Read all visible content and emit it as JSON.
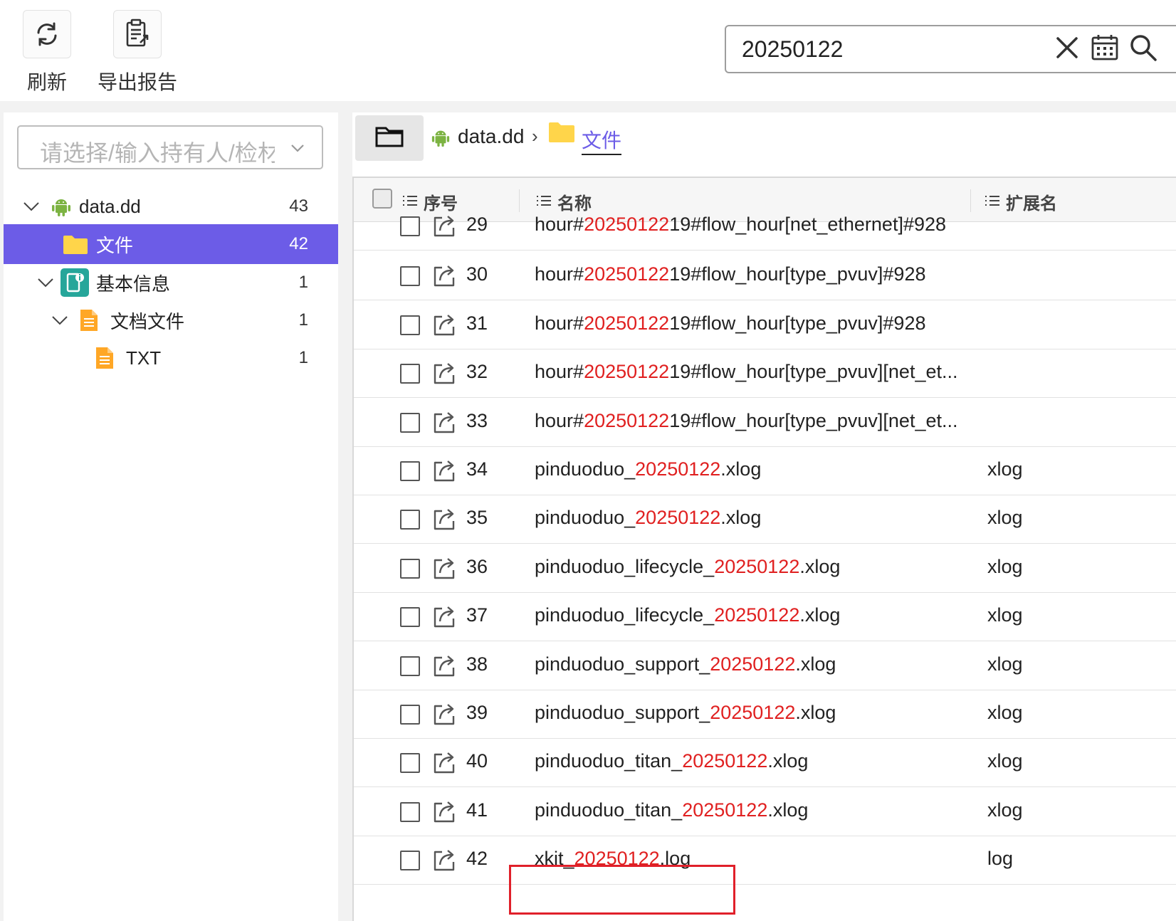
{
  "toolbar": {
    "refresh_label": "刷新",
    "export_label": "导出报告"
  },
  "search": {
    "value": "20250122"
  },
  "left": {
    "owner_placeholder": "请选择/输入持有人/检材",
    "tree": [
      {
        "label": "data.dd",
        "count": "43",
        "level": 0,
        "icon": "android-icon",
        "expanded": true
      },
      {
        "label": "文件",
        "count": "42",
        "level": 1,
        "icon": "folder-icon",
        "selected": true
      },
      {
        "label": "基本信息",
        "count": "1",
        "level": 1,
        "icon": "device-info-icon",
        "expanded": true
      },
      {
        "label": "文档文件",
        "count": "1",
        "level": 2,
        "icon": "document-icon",
        "expanded": true
      },
      {
        "label": "TXT",
        "count": "1",
        "level": 3,
        "icon": "document-icon"
      }
    ]
  },
  "breadcrumb": {
    "root": "data.dd",
    "current": "文件"
  },
  "table": {
    "headers": {
      "index": "序号",
      "name": "名称",
      "ext": "扩展名"
    },
    "rows": [
      {
        "num": "29",
        "pre": "hour#",
        "hl": "20250122",
        "post": "19#flow_hour[net_ethernet]#928",
        "ext": ""
      },
      {
        "num": "30",
        "pre": "hour#",
        "hl": "20250122",
        "post": "19#flow_hour[type_pvuv]#928",
        "ext": ""
      },
      {
        "num": "31",
        "pre": "hour#",
        "hl": "20250122",
        "post": "19#flow_hour[type_pvuv]#928",
        "ext": ""
      },
      {
        "num": "32",
        "pre": "hour#",
        "hl": "20250122",
        "post": "19#flow_hour[type_pvuv][net_et...",
        "ext": ""
      },
      {
        "num": "33",
        "pre": "hour#",
        "hl": "20250122",
        "post": "19#flow_hour[type_pvuv][net_et...",
        "ext": ""
      },
      {
        "num": "34",
        "pre": "pinduoduo_",
        "hl": "20250122",
        "post": ".xlog",
        "ext": "xlog"
      },
      {
        "num": "35",
        "pre": "pinduoduo_",
        "hl": "20250122",
        "post": ".xlog",
        "ext": "xlog"
      },
      {
        "num": "36",
        "pre": "pinduoduo_lifecycle_",
        "hl": "20250122",
        "post": ".xlog",
        "ext": "xlog"
      },
      {
        "num": "37",
        "pre": "pinduoduo_lifecycle_",
        "hl": "20250122",
        "post": ".xlog",
        "ext": "xlog"
      },
      {
        "num": "38",
        "pre": "pinduoduo_support_",
        "hl": "20250122",
        "post": ".xlog",
        "ext": "xlog"
      },
      {
        "num": "39",
        "pre": "pinduoduo_support_",
        "hl": "20250122",
        "post": ".xlog",
        "ext": "xlog"
      },
      {
        "num": "40",
        "pre": "pinduoduo_titan_",
        "hl": "20250122",
        "post": ".xlog",
        "ext": "xlog"
      },
      {
        "num": "41",
        "pre": "pinduoduo_titan_",
        "hl": "20250122",
        "post": ".xlog",
        "ext": "xlog"
      },
      {
        "num": "42",
        "pre": "xkit_",
        "hl": "20250122",
        "post": ".log",
        "ext": "log"
      }
    ]
  },
  "colors": {
    "accent": "#6c5ce7",
    "highlight_text": "#e02020",
    "annotation_box": "#e0202a",
    "folder": "#ffd54a",
    "android": "#7cb342",
    "info_teal": "#26a69a",
    "doc_orange": "#ffa726"
  }
}
